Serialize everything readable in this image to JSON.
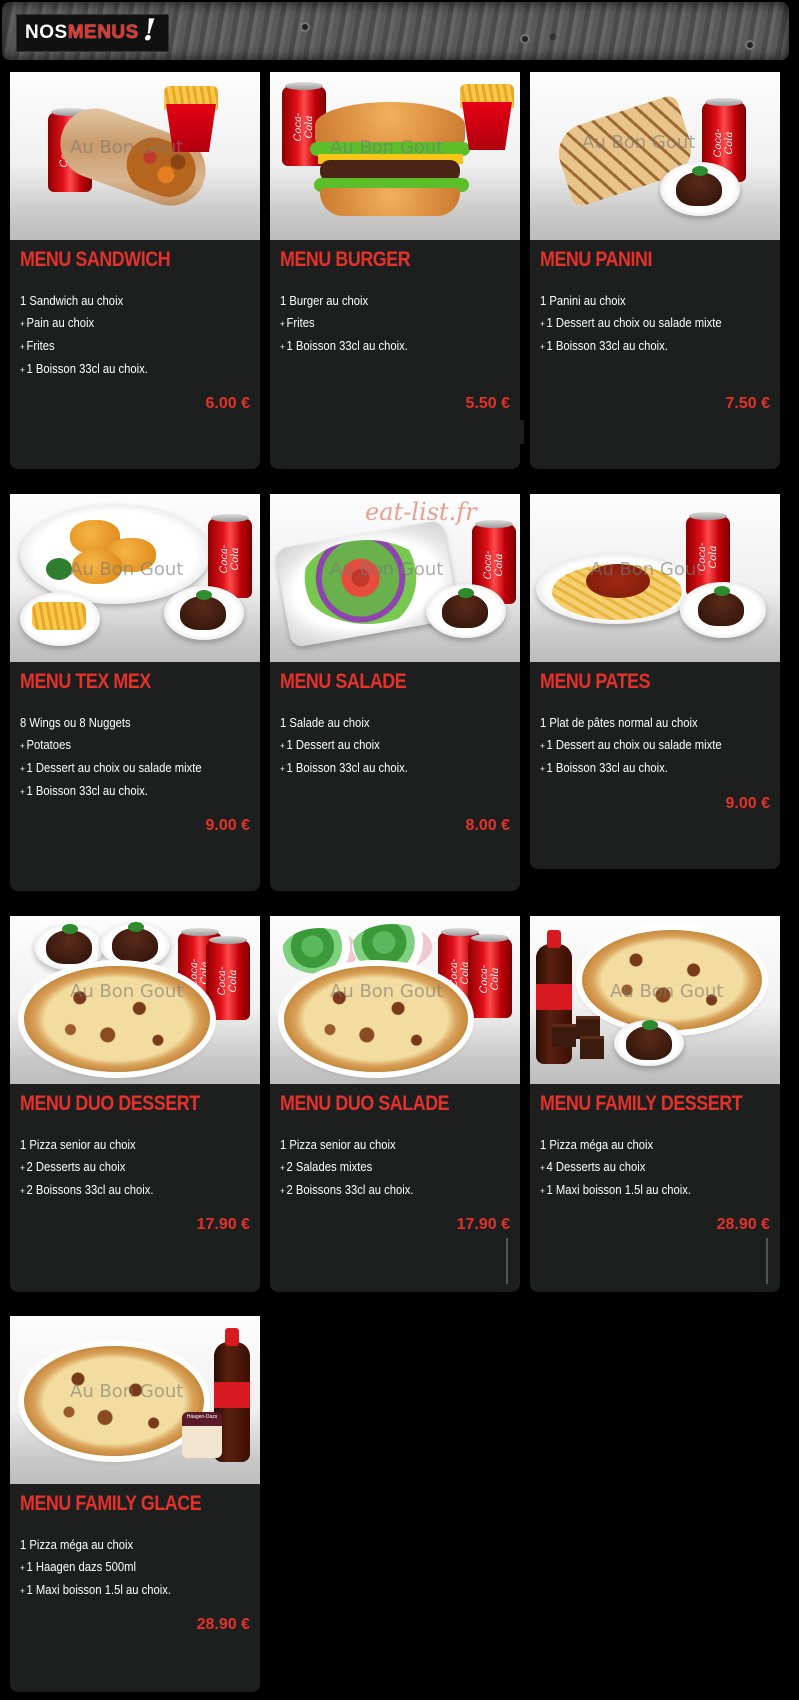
{
  "header": {
    "logo_part1": "NOS",
    "logo_part2": "MENUS",
    "logo_part3": "!"
  },
  "watermark": "Au Bon Gout",
  "site_watermark": "eat-list.fr",
  "menus": [
    {
      "title": "MENU SANDWICH",
      "items": [
        "1 Sandwich au choix",
        "Pain au choix",
        "Frites",
        "1 Boisson 33cl au choix."
      ],
      "price": "6.00 €"
    },
    {
      "title": "MENU BURGER",
      "items": [
        "1 Burger au choix",
        "Frites",
        "1 Boisson 33cl au choix."
      ],
      "price": "5.50 €"
    },
    {
      "title": "MENU PANINI",
      "items": [
        "1 Panini au choix",
        "1 Dessert au choix ou salade mixte",
        "1 Boisson 33cl au choix."
      ],
      "price": "7.50 €"
    },
    {
      "title": "MENU TEX MEX",
      "items": [
        "8 Wings ou 8 Nuggets",
        "Potatoes",
        "1 Dessert au choix ou salade mixte",
        "1 Boisson 33cl au choix."
      ],
      "price": "9.00 €"
    },
    {
      "title": "MENU SALADE",
      "items": [
        "1 Salade au choix",
        "1 Dessert au choix",
        "1 Boisson 33cl au choix."
      ],
      "price": "8.00 €"
    },
    {
      "title": "MENU PATES",
      "items": [
        "1 Plat de pâtes normal au choix",
        "1 Dessert au choix ou salade mixte",
        "1 Boisson 33cl au choix."
      ],
      "price": "9.00 €"
    },
    {
      "title": "MENU DUO DESSERT",
      "items": [
        "1 Pizza senior au choix",
        "2 Desserts au choix",
        "2 Boissons 33cl au choix."
      ],
      "price": "17.90 €"
    },
    {
      "title": "MENU DUO SALADE",
      "items": [
        "1 Pizza senior au choix",
        "2 Salades mixtes",
        "2 Boissons 33cl au choix."
      ],
      "price": "17.90 €"
    },
    {
      "title": "MENU FAMILY DESSERT",
      "items": [
        "1 Pizza méga au choix",
        "4 Desserts au choix",
        "1 Maxi boisson 1.5l au choix."
      ],
      "price": "28.90 €"
    },
    {
      "title": "MENU FAMILY GLACE",
      "items": [
        "1 Pizza méga au choix",
        "1 Haagen dazs 500ml",
        "1 Maxi boisson 1.5l au choix."
      ],
      "price": "28.90 €"
    }
  ],
  "can_label": "Coca-Cola",
  "icecream_label": "Häagen-Dazs",
  "colors": {
    "accent": "#e4322b",
    "card_bg": "#1d1f1f",
    "page_bg": "#000000"
  }
}
